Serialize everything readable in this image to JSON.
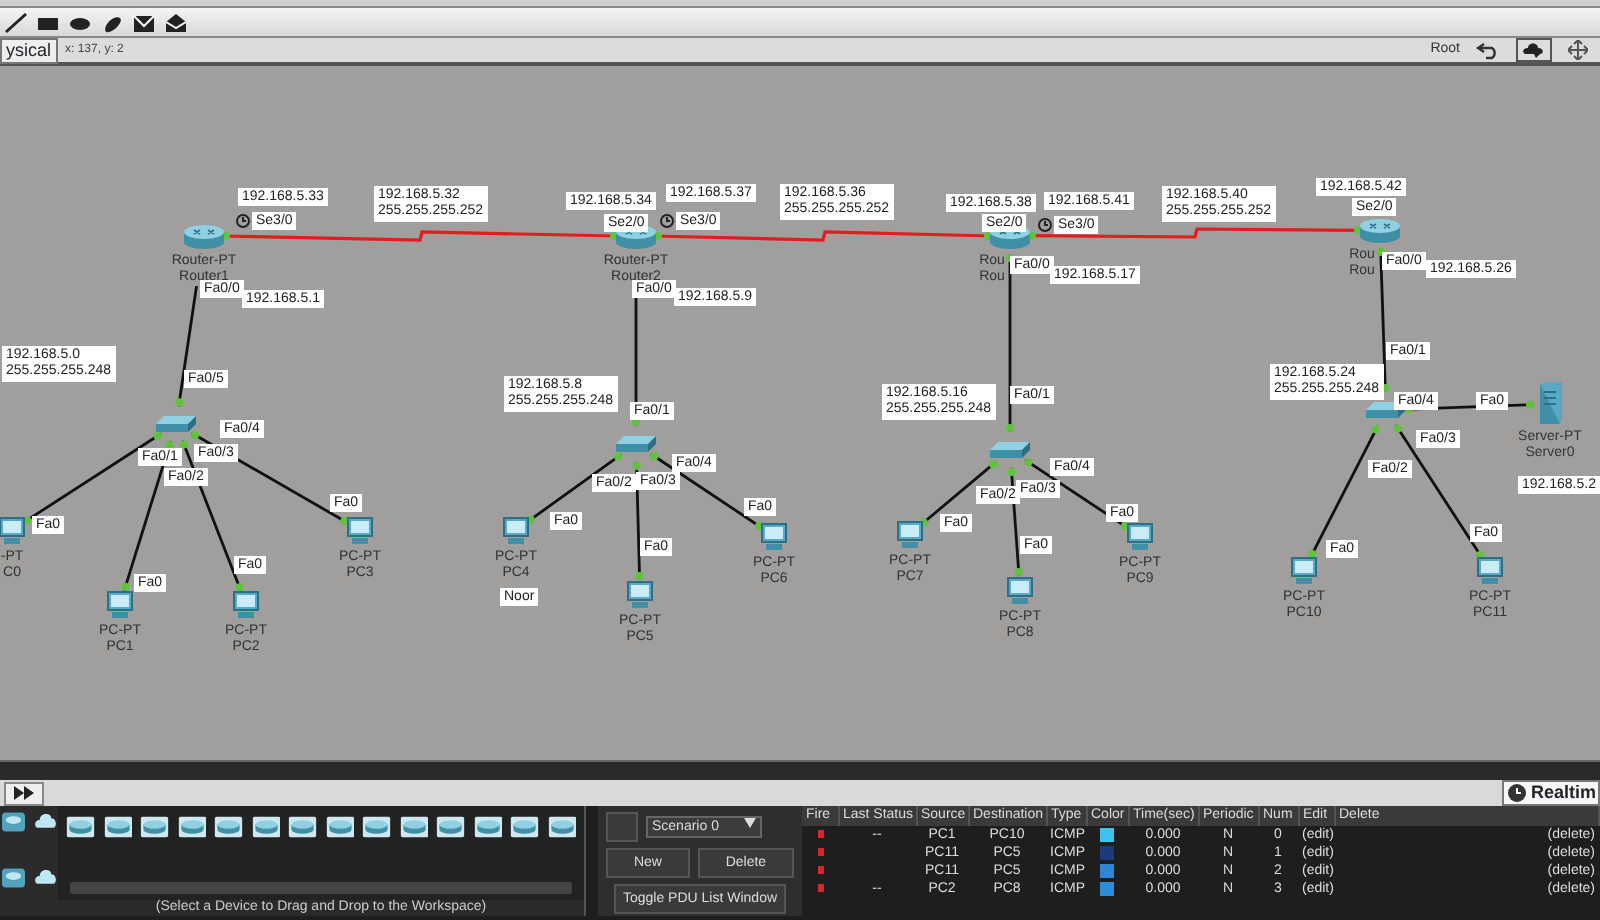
{
  "workspace": {
    "mode_tab": "ysical",
    "coordinates": "x: 137, y: 2",
    "path": "Root"
  },
  "devices": [
    {
      "kind": "router",
      "labels": [
        "Router-PT",
        "Router1"
      ]
    },
    {
      "kind": "router",
      "labels": [
        "Router-PT",
        "Router2"
      ]
    },
    {
      "kind": "router",
      "labels": [
        "Rou",
        "Rou"
      ]
    },
    {
      "kind": "router",
      "labels": [
        "Rou",
        "Rou"
      ]
    },
    {
      "kind": "switch"
    },
    {
      "kind": "switch"
    },
    {
      "kind": "switch"
    },
    {
      "kind": "switch"
    },
    {
      "kind": "pc",
      "labels": [
        "-PT",
        "C0"
      ]
    },
    {
      "kind": "pc",
      "labels": [
        "PC-PT",
        "PC1"
      ]
    },
    {
      "kind": "pc",
      "labels": [
        "PC-PT",
        "PC2"
      ]
    },
    {
      "kind": "pc",
      "labels": [
        "PC-PT",
        "PC3"
      ]
    },
    {
      "kind": "pc",
      "labels": [
        "PC-PT",
        "PC4"
      ]
    },
    {
      "kind": "pc",
      "labels": [
        "PC-PT",
        "PC5"
      ]
    },
    {
      "kind": "pc",
      "labels": [
        "PC-PT",
        "PC6"
      ]
    },
    {
      "kind": "pc",
      "labels": [
        "PC-PT",
        "PC7"
      ]
    },
    {
      "kind": "pc",
      "labels": [
        "PC-PT",
        "PC8"
      ]
    },
    {
      "kind": "pc",
      "labels": [
        "PC-PT",
        "PC9"
      ]
    },
    {
      "kind": "pc",
      "labels": [
        "PC-PT",
        "PC10"
      ]
    },
    {
      "kind": "pc",
      "labels": [
        "PC-PT",
        "PC11"
      ]
    },
    {
      "kind": "server",
      "labels": [
        "Server-PT",
        "Server0"
      ]
    }
  ],
  "links": [
    {
      "kind": "serial"
    },
    {
      "kind": "serial"
    },
    {
      "kind": "serial"
    },
    {
      "kind": "ethernet"
    },
    {
      "kind": "ethernet"
    },
    {
      "kind": "ethernet"
    },
    {
      "kind": "ethernet"
    },
    {
      "kind": "ethernet"
    },
    {
      "kind": "ethernet"
    },
    {
      "kind": "ethernet"
    },
    {
      "kind": "ethernet"
    },
    {
      "kind": "ethernet"
    },
    {
      "kind": "ethernet"
    },
    {
      "kind": "ethernet"
    },
    {
      "kind": "ethernet"
    },
    {
      "kind": "ethernet"
    },
    {
      "kind": "ethernet"
    },
    {
      "kind": "ethernet"
    },
    {
      "kind": "ethernet"
    },
    {
      "kind": "ethernet"
    }
  ],
  "labels": [
    {
      "kind": "port",
      "text": "192.168.5.33"
    },
    {
      "kind": "clock",
      "text": "Se3/0"
    },
    {
      "kind": "note",
      "lines": [
        "192.168.5.32",
        "255.255.255.252"
      ]
    },
    {
      "kind": "port",
      "text": "192.168.5.34"
    },
    {
      "kind": "port",
      "text": "192.168.5.37"
    },
    {
      "kind": "port",
      "text": "Se2/0"
    },
    {
      "kind": "clock",
      "text": "Se3/0"
    },
    {
      "kind": "note",
      "lines": [
        "192.168.5.36",
        "255.255.255.252"
      ]
    },
    {
      "kind": "port",
      "text": "192.168.5.38"
    },
    {
      "kind": "port",
      "text": "192.168.5.41"
    },
    {
      "kind": "port",
      "text": "Se2/0"
    },
    {
      "kind": "clock",
      "text": "Se3/0"
    },
    {
      "kind": "note",
      "lines": [
        "192.168.5.40",
        "255.255.255.252"
      ]
    },
    {
      "kind": "port",
      "text": "192.168.5.42"
    },
    {
      "kind": "port",
      "text": "Se2/0"
    },
    {
      "kind": "port",
      "text": "Fa0/0"
    },
    {
      "kind": "port",
      "text": "192.168.5.1"
    },
    {
      "kind": "port",
      "text": "Fa0/0"
    },
    {
      "kind": "port",
      "text": "192.168.5.9"
    },
    {
      "kind": "port",
      "text": "Fa0/0"
    },
    {
      "kind": "port",
      "text": "192.168.5.17"
    },
    {
      "kind": "port",
      "text": "Fa0/0"
    },
    {
      "kind": "port",
      "text": "192.168.5.26"
    },
    {
      "kind": "note",
      "lines": [
        "192.168.5.0",
        "255.255.255.248"
      ]
    },
    {
      "kind": "port",
      "text": "Fa0/5"
    },
    {
      "kind": "port",
      "text": "Fa0/4"
    },
    {
      "kind": "port",
      "text": "Fa0/1"
    },
    {
      "kind": "port",
      "text": "Fa0/3"
    },
    {
      "kind": "port",
      "text": "Fa0/2"
    },
    {
      "kind": "port",
      "text": "Fa0"
    },
    {
      "kind": "port",
      "text": "Fa0"
    },
    {
      "kind": "port",
      "text": "Fa0"
    },
    {
      "kind": "port",
      "text": "Fa0"
    },
    {
      "kind": "note",
      "lines": [
        "192.168.5.8",
        "255.255.255.248"
      ]
    },
    {
      "kind": "port",
      "text": "Fa0/1"
    },
    {
      "kind": "port",
      "text": "Fa0/4"
    },
    {
      "kind": "port",
      "text": "Fa0/2"
    },
    {
      "kind": "port",
      "text": "Fa0/3"
    },
    {
      "kind": "port",
      "text": "Fa0"
    },
    {
      "kind": "port",
      "text": "Fa0"
    },
    {
      "kind": "port",
      "text": "Fa0"
    },
    {
      "kind": "port",
      "text": "Noor"
    },
    {
      "kind": "note",
      "lines": [
        "192.168.5.16",
        "255.255.255.248"
      ]
    },
    {
      "kind": "port",
      "text": "Fa0/1"
    },
    {
      "kind": "port",
      "text": "Fa0/4"
    },
    {
      "kind": "port",
      "text": "Fa0/2"
    },
    {
      "kind": "port",
      "text": "Fa0/3"
    },
    {
      "kind": "port",
      "text": "Fa0"
    },
    {
      "kind": "port",
      "text": "Fa0"
    },
    {
      "kind": "port",
      "text": "Fa0"
    },
    {
      "kind": "port",
      "text": "Fa0/1"
    },
    {
      "kind": "note",
      "lines": [
        "192.168.5.24",
        "255.255.255.248"
      ]
    },
    {
      "kind": "port",
      "text": "Fa0/4"
    },
    {
      "kind": "port",
      "text": "Fa0"
    },
    {
      "kind": "port",
      "text": "Fa0/3"
    },
    {
      "kind": "port",
      "text": "Fa0/2"
    },
    {
      "kind": "port",
      "text": "Fa0"
    },
    {
      "kind": "port",
      "text": "Fa0"
    },
    {
      "kind": "port",
      "text": "192.168.5.2"
    }
  ],
  "mode": {
    "label": "Realtim"
  },
  "palette": {
    "hint": "(Select a Device to Drag and Drop to the Workspace)"
  },
  "scenario": {
    "value": "Scenario 0",
    "buttons": [
      "New",
      "Delete"
    ],
    "toggle": "Toggle PDU List Window"
  },
  "pdu_table": {
    "columns": [
      "Fire",
      "Last Status",
      "Source",
      "Destination",
      "Type",
      "Color",
      "Time(sec)",
      "Periodic",
      "Num",
      "Edit",
      "Delete"
    ],
    "rows": [
      {
        "last_status": "--",
        "source": "PC1",
        "destination": "PC10",
        "type": "ICMP",
        "color": "#3cc4ec",
        "time": "0.000",
        "periodic": "N",
        "num": "0",
        "edit": "(edit)",
        "delete": "(delete)"
      },
      {
        "source": "PC11",
        "destination": "PC5",
        "type": "ICMP",
        "color": "#1d3b7c",
        "time": "0.000",
        "periodic": "N",
        "num": "1",
        "edit": "(edit)",
        "delete": "(delete)"
      },
      {
        "source": "PC11",
        "destination": "PC5",
        "type": "ICMP",
        "color": "#2f86d6",
        "time": "0.000",
        "periodic": "N",
        "num": "2",
        "edit": "(edit)",
        "delete": "(delete)"
      },
      {
        "last_status": "--",
        "source": "PC2",
        "destination": "PC8",
        "type": "ICMP",
        "color": "#2b8fd8",
        "time": "0.000",
        "periodic": "N",
        "num": "3",
        "edit": "(edit)",
        "delete": "(delete)"
      }
    ]
  }
}
